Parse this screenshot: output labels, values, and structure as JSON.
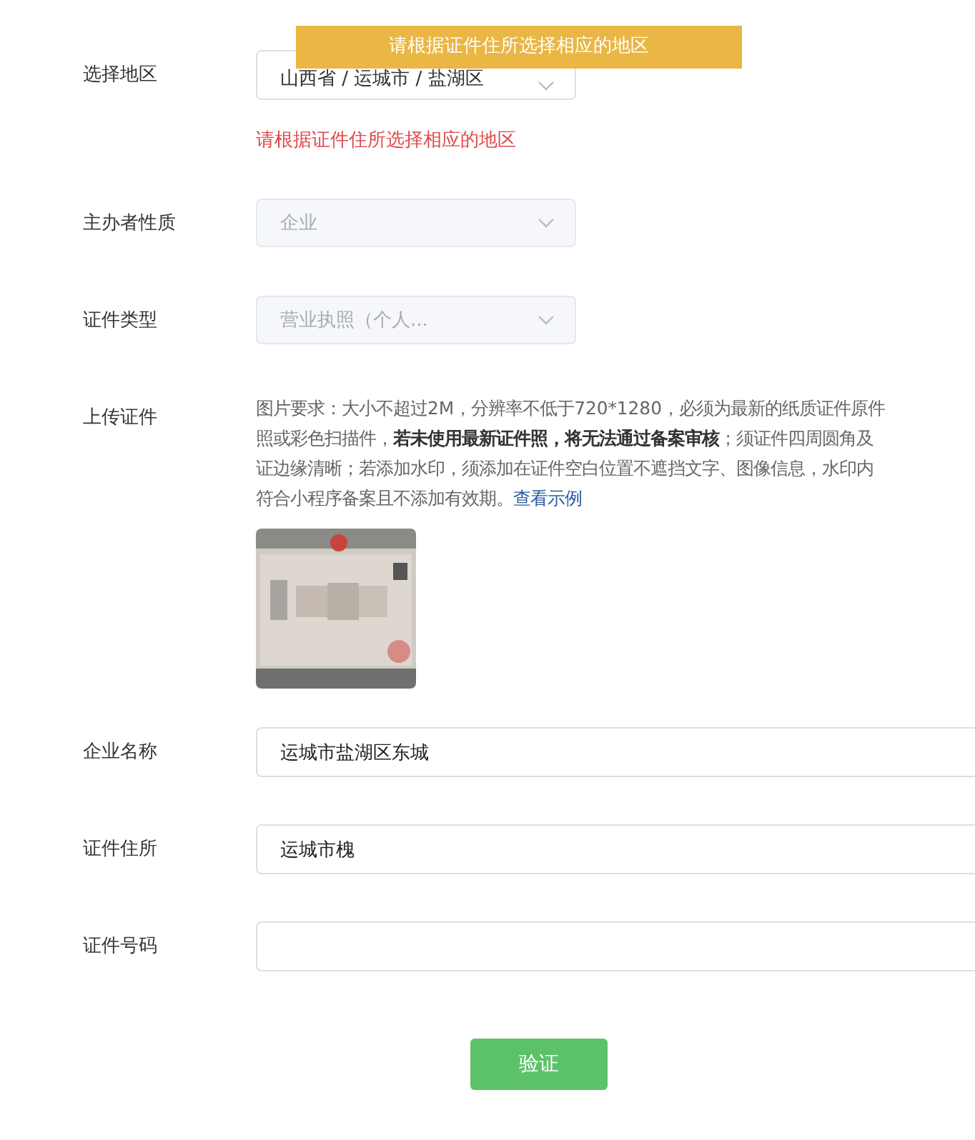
{
  "toast": {
    "text": "请根据证件住所选择相应的地区"
  },
  "fields": [
    {
      "kind": "cascader",
      "label": "选择地区",
      "value": "山西省 / 运城市 / 盐湖区",
      "disabled": false,
      "error": "请根据证件住所选择相应的地区"
    },
    {
      "kind": "select",
      "label": "主办者性质",
      "value": "企业",
      "disabled": true
    },
    {
      "kind": "select",
      "label": "证件类型",
      "value": "营业执照（个人...",
      "disabled": true
    },
    {
      "kind": "upload",
      "label": "上传证件",
      "lines": [
        "图片要求：大小不超过2M，分辨率不低于720*1280，必须为最新的纸质证件原件",
        "照或彩色扫描件，**若未使用最新证件照，将无法通过备案审核**；须证件四周圆角及",
        "证边缘清晰；若添加水印，须添加在证件空白位置不遮挡文字、图像信息，水印内",
        "符合小程序备案且不添加有效期。"
      ],
      "link": "查看示例"
    },
    {
      "kind": "input",
      "label": "企业名称",
      "value": "运城市盐湖区东城"
    },
    {
      "kind": "input",
      "label": "证件住所",
      "value": "运城市槐"
    },
    {
      "kind": "input",
      "label": "证件号码"
    }
  ],
  "submit": {
    "label": "验证"
  }
}
